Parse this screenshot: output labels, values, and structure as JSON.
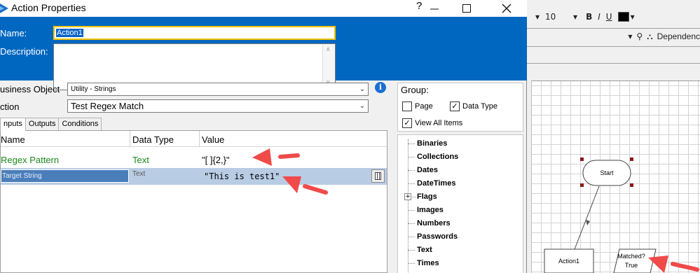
{
  "dialog": {
    "title": "Action Properties",
    "help_glyph": "?",
    "name_label": "Name:",
    "name_value": "Action1",
    "description_label": "Description:",
    "description_value": "",
    "business_object_label": "usiness Object",
    "business_object_value": "Utility - Strings",
    "action_label": "ction",
    "action_value": "Test Regex Match",
    "tabs": [
      {
        "label": "nputs",
        "active": true
      },
      {
        "label": "Outputs",
        "active": false
      },
      {
        "label": "Conditions",
        "active": false
      }
    ],
    "grid": {
      "columns": [
        "Name",
        "Data Type",
        "Value"
      ],
      "rows": [
        {
          "name": "Regex Pattern",
          "type": "Text",
          "value": "\"[ ]{2,}\""
        },
        {
          "name": "Target String",
          "type": "Text",
          "value": "\"This is  test1\""
        }
      ]
    },
    "group": {
      "title": "Group:",
      "page_label": "Page",
      "page_checked": false,
      "data_type_label": "Data Type",
      "data_type_checked": true,
      "view_all_label": "View All Items",
      "view_all_checked": true
    },
    "data_items": [
      "Binaries",
      "Collections",
      "Dates",
      "DateTimes",
      "Flags",
      "Images",
      "Numbers",
      "Passwords",
      "Text",
      "Times"
    ]
  },
  "background_app": {
    "font_size": "10",
    "bold": "B",
    "italic": "I",
    "underline": "U",
    "dependencies_label": "Dependenc",
    "diagram": {
      "start_label": "Start",
      "action_label": "Action1",
      "decision_line1": "Matched?",
      "decision_line2": "True"
    }
  },
  "colors": {
    "header_blue": "#0067c0",
    "name_highlight": "#f3c300",
    "row_selected": "#b8cce4",
    "green_text": "#1a8a1a",
    "annotation_arrow": "#f04a4a"
  }
}
